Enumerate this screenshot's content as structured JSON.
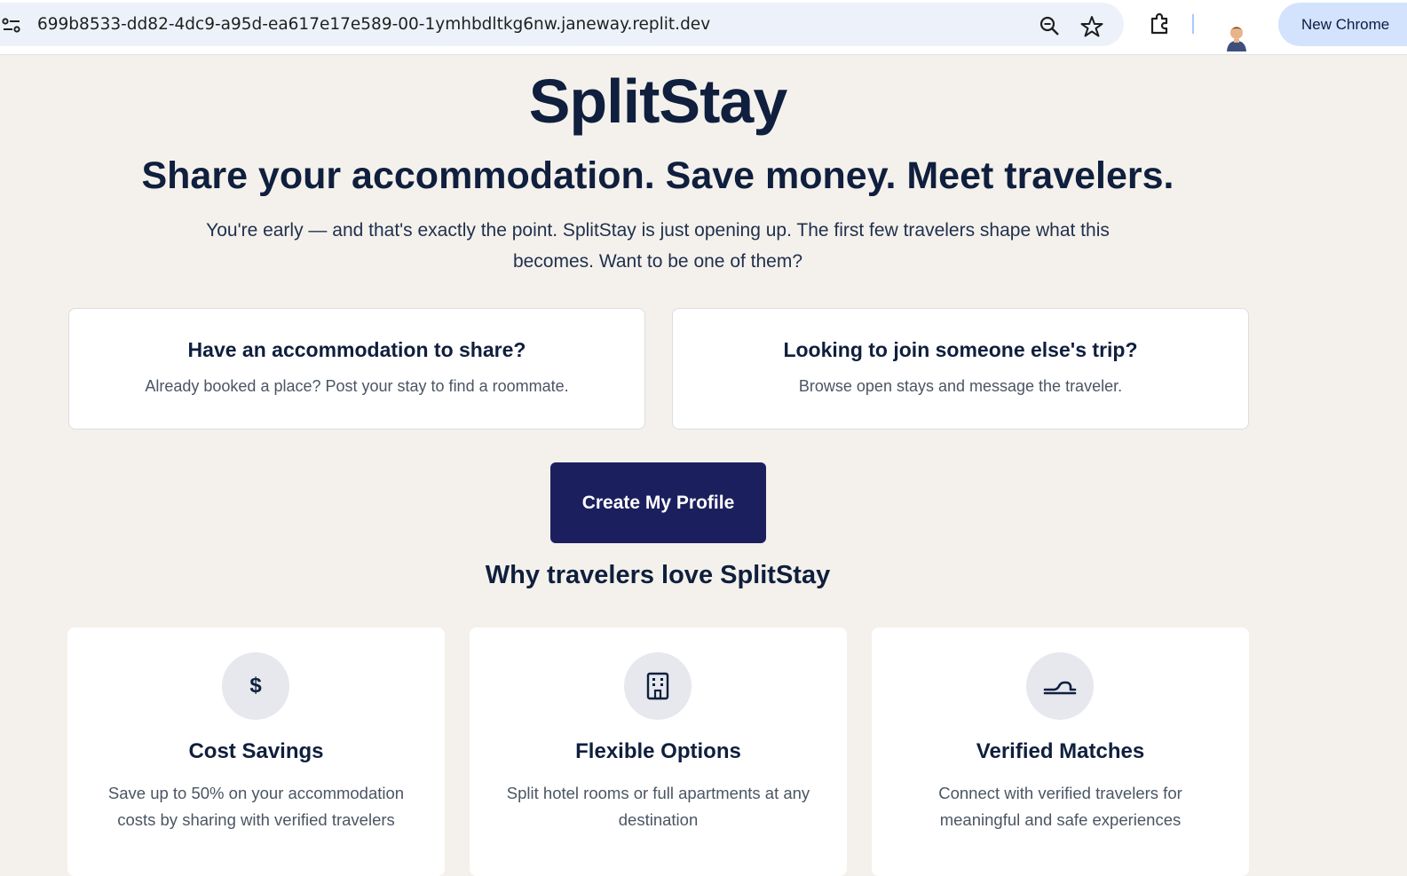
{
  "browser": {
    "url": "699b8533-dd82-4dc9-a95d-ea617e17e589-00-1ymhbdltkg6nw.janeway.replit.dev",
    "new_chrome_label": "New Chrome",
    "icons": [
      "site-info-icon",
      "zoom-icon",
      "star-icon",
      "extensions-icon",
      "avatar"
    ]
  },
  "hero": {
    "brand": "SplitStay",
    "headline": "Share your accommodation. Save money. Meet travelers.",
    "intro": "You're early — and that's exactly the point. SplitStay is just opening up. The first few travelers shape what this becomes. Want to be one of them?"
  },
  "choices": [
    {
      "title": "Have an accommodation to share?",
      "description": "Already booked a place? Post your stay to find a roommate."
    },
    {
      "title": "Looking to join someone else's trip?",
      "description": "Browse open stays and message the traveler."
    }
  ],
  "cta": {
    "label": "Create My Profile"
  },
  "features": {
    "heading": "Why travelers love SplitStay",
    "items": [
      {
        "icon": "dollar-icon",
        "glyph": "$",
        "title": "Cost Savings",
        "description": "Save up to 50% on your accommodation costs by sharing with verified travelers"
      },
      {
        "icon": "building-icon",
        "title": "Flexible Options",
        "description": "Split hotel rooms or full apartments at any destination"
      },
      {
        "icon": "handshake-icon",
        "title": "Verified Matches",
        "description": "Connect with verified travelers for meaningful and safe experiences"
      }
    ]
  },
  "colors": {
    "page_background": "#f4f1ec",
    "navy_text": "#0f1f3d",
    "cta_background": "#1c1f5e",
    "icon_circle": "#e6e8ee"
  }
}
